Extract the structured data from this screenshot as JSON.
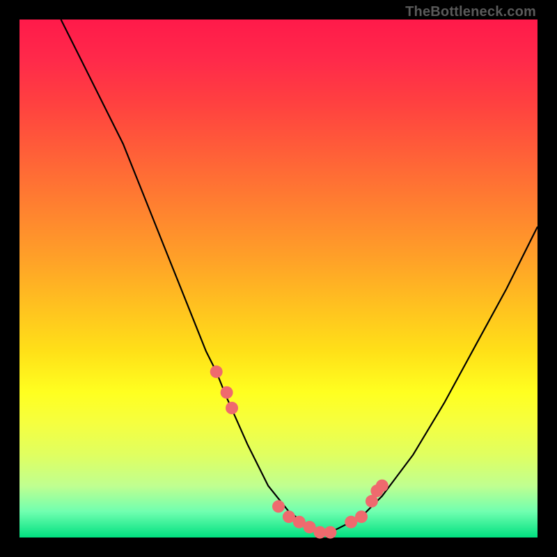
{
  "watermark": "TheBottleneck.com",
  "colors": {
    "background": "#000000",
    "gradient_top": "#ff1a4a",
    "gradient_bottom": "#00e080",
    "curve_stroke": "#000000",
    "marker_fill": "#ef6a6e"
  },
  "chart_data": {
    "type": "line",
    "title": "",
    "xlabel": "",
    "ylabel": "",
    "xlim": [
      0,
      1
    ],
    "ylim": [
      0,
      1
    ],
    "series": [
      {
        "name": "curve",
        "x": [
          0.08,
          0.12,
          0.16,
          0.2,
          0.24,
          0.28,
          0.32,
          0.36,
          0.38,
          0.4,
          0.44,
          0.48,
          0.52,
          0.56,
          0.58,
          0.6,
          0.64,
          0.66,
          0.7,
          0.76,
          0.82,
          0.88,
          0.94,
          1.0
        ],
        "y": [
          0.0,
          0.08,
          0.16,
          0.24,
          0.34,
          0.44,
          0.54,
          0.64,
          0.68,
          0.73,
          0.82,
          0.9,
          0.95,
          0.98,
          0.99,
          0.99,
          0.97,
          0.96,
          0.92,
          0.84,
          0.74,
          0.63,
          0.52,
          0.4
        ]
      }
    ],
    "markers": {
      "name": "highlight-points",
      "x": [
        0.38,
        0.4,
        0.41,
        0.5,
        0.52,
        0.54,
        0.56,
        0.58,
        0.6,
        0.64,
        0.66,
        0.68,
        0.69,
        0.7
      ],
      "y": [
        0.68,
        0.72,
        0.75,
        0.94,
        0.96,
        0.97,
        0.98,
        0.99,
        0.99,
        0.97,
        0.96,
        0.93,
        0.91,
        0.9
      ]
    }
  }
}
